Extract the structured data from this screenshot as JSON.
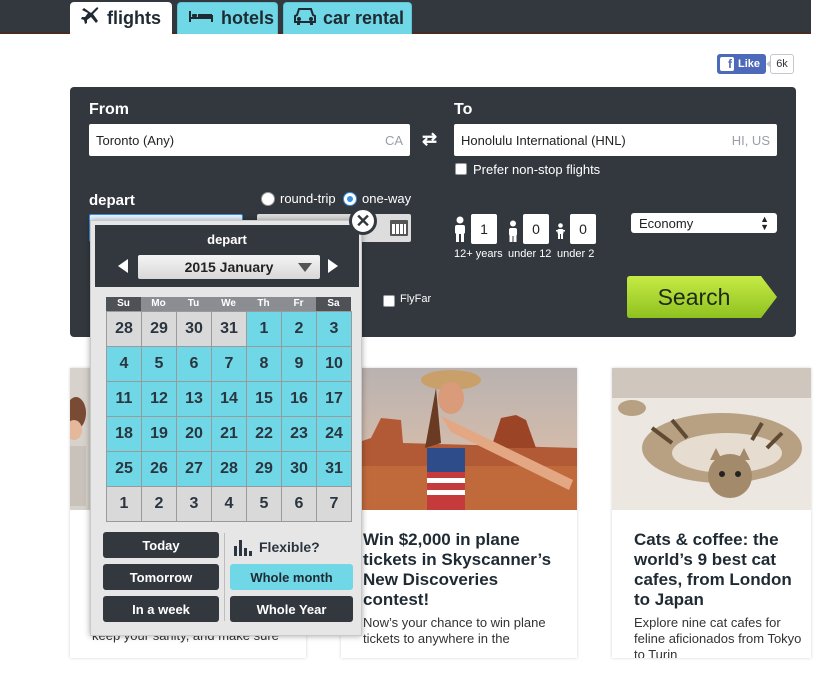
{
  "nav": {
    "tabs": [
      {
        "label": "flights",
        "active": true,
        "icon": "plane-icon"
      },
      {
        "label": "hotels",
        "active": false,
        "icon": "bed-icon"
      },
      {
        "label": "car rental",
        "active": false,
        "icon": "car-icon"
      }
    ]
  },
  "social": {
    "like_label": "Like",
    "like_count": "6k",
    "fb_letter": "f"
  },
  "search": {
    "from_label": "From",
    "from_value": "Toronto (Any)",
    "from_hint": "CA",
    "to_label": "To",
    "to_value": "Honolulu International (HNL)",
    "to_hint": "HI, US",
    "swap_symbol": "⇄",
    "prefer_nonstop_label": "Prefer non-stop flights",
    "depart_label": "depart",
    "trip_options": [
      {
        "label": "round-trip",
        "selected": false
      },
      {
        "label": "one-way",
        "selected": true
      }
    ],
    "flyfar_label": "FlyFar",
    "passengers": [
      {
        "label": "12+ years",
        "value": "1"
      },
      {
        "label": "under 12",
        "value": "0"
      },
      {
        "label": "under 2",
        "value": "0"
      }
    ],
    "cabin_class": "Economy",
    "search_button": "Search"
  },
  "datepicker": {
    "title": "depart",
    "month_label": "2015 January",
    "weekdays": [
      "Su",
      "Mo",
      "Tu",
      "We",
      "Th",
      "Fr",
      "Sa"
    ],
    "days": [
      {
        "d": "28",
        "cur": false
      },
      {
        "d": "29",
        "cur": false
      },
      {
        "d": "30",
        "cur": false
      },
      {
        "d": "31",
        "cur": false
      },
      {
        "d": "1",
        "cur": true
      },
      {
        "d": "2",
        "cur": true
      },
      {
        "d": "3",
        "cur": true
      },
      {
        "d": "4",
        "cur": true
      },
      {
        "d": "5",
        "cur": true
      },
      {
        "d": "6",
        "cur": true
      },
      {
        "d": "7",
        "cur": true
      },
      {
        "d": "8",
        "cur": true
      },
      {
        "d": "9",
        "cur": true
      },
      {
        "d": "10",
        "cur": true
      },
      {
        "d": "11",
        "cur": true
      },
      {
        "d": "12",
        "cur": true
      },
      {
        "d": "13",
        "cur": true
      },
      {
        "d": "14",
        "cur": true
      },
      {
        "d": "15",
        "cur": true
      },
      {
        "d": "16",
        "cur": true
      },
      {
        "d": "17",
        "cur": true
      },
      {
        "d": "18",
        "cur": true
      },
      {
        "d": "19",
        "cur": true
      },
      {
        "d": "20",
        "cur": true
      },
      {
        "d": "21",
        "cur": true
      },
      {
        "d": "22",
        "cur": true
      },
      {
        "d": "23",
        "cur": true
      },
      {
        "d": "24",
        "cur": true
      },
      {
        "d": "25",
        "cur": true
      },
      {
        "d": "26",
        "cur": true
      },
      {
        "d": "27",
        "cur": true
      },
      {
        "d": "28",
        "cur": true
      },
      {
        "d": "29",
        "cur": true
      },
      {
        "d": "30",
        "cur": true
      },
      {
        "d": "31",
        "cur": true
      },
      {
        "d": "1",
        "cur": false
      },
      {
        "d": "2",
        "cur": false
      },
      {
        "d": "3",
        "cur": false
      },
      {
        "d": "4",
        "cur": false
      },
      {
        "d": "5",
        "cur": false
      },
      {
        "d": "6",
        "cur": false
      },
      {
        "d": "7",
        "cur": false
      }
    ],
    "today_label": "Today",
    "tomorrow_label": "Tomorrow",
    "in_a_week_label": "In a week",
    "flexible_label": "Flexible?",
    "whole_month_label": "Whole month",
    "whole_year_label": "Whole Year",
    "close_symbol": "✕"
  },
  "articles": [
    {
      "title": "",
      "text": "keep your sanity, and make sure"
    },
    {
      "title": "Win $2,000 in plane tickets in Skyscanner’s New Discoveries contest!",
      "text": "Now’s your chance to win plane tickets to anywhere in the"
    },
    {
      "title": "Cats & coffee: the world’s 9 best cat cafes, from London to Japan",
      "text": "Explore nine cat cafes for feline aficionados from Tokyo to Turin"
    }
  ],
  "colors": {
    "accent": "#6fd7e6",
    "panel": "#33383f",
    "search_green": "#a9d92c",
    "radio_blue": "#3b8de0"
  }
}
